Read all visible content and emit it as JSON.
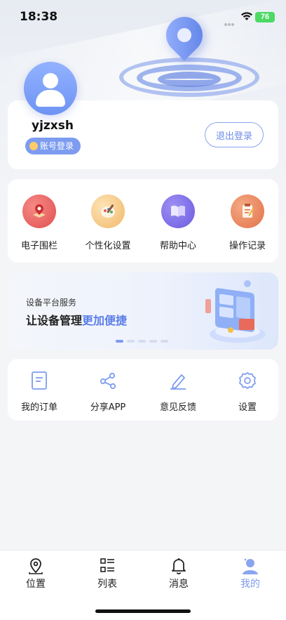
{
  "status_bar": {
    "time": "18:38",
    "battery": "76"
  },
  "profile": {
    "username": "yjzxsh",
    "login_type": "账号登录",
    "logout_label": "退出登录"
  },
  "features": [
    {
      "label": "电子围栏",
      "icon": "geofence-icon",
      "color": "#e8605f"
    },
    {
      "label": "个性化设置",
      "icon": "palette-icon",
      "color": "#f4c17a"
    },
    {
      "label": "帮助中心",
      "icon": "book-icon",
      "color": "#7e6fe6"
    },
    {
      "label": "操作记录",
      "icon": "clipboard-icon",
      "color": "#ea8a5e"
    }
  ],
  "banner": {
    "subtitle": "设备平台服务",
    "headline_part1": "让设备管理",
    "headline_part2": "更加便捷",
    "slide_count": 5,
    "active_slide": 1
  },
  "tools": [
    {
      "label": "我的订单",
      "icon": "order-icon"
    },
    {
      "label": "分享APP",
      "icon": "share-icon"
    },
    {
      "label": "意见反馈",
      "icon": "feedback-pen-icon"
    },
    {
      "label": "设置",
      "icon": "gear-icon"
    }
  ],
  "tabbar": {
    "tabs": [
      {
        "label": "位置",
        "icon": "location-pin-icon"
      },
      {
        "label": "列表",
        "icon": "list-icon"
      },
      {
        "label": "消息",
        "icon": "bell-icon"
      },
      {
        "label": "我的",
        "icon": "user-icon",
        "active": true
      }
    ]
  },
  "colors": {
    "accent": "#7d9cf0",
    "text": "#222222"
  }
}
